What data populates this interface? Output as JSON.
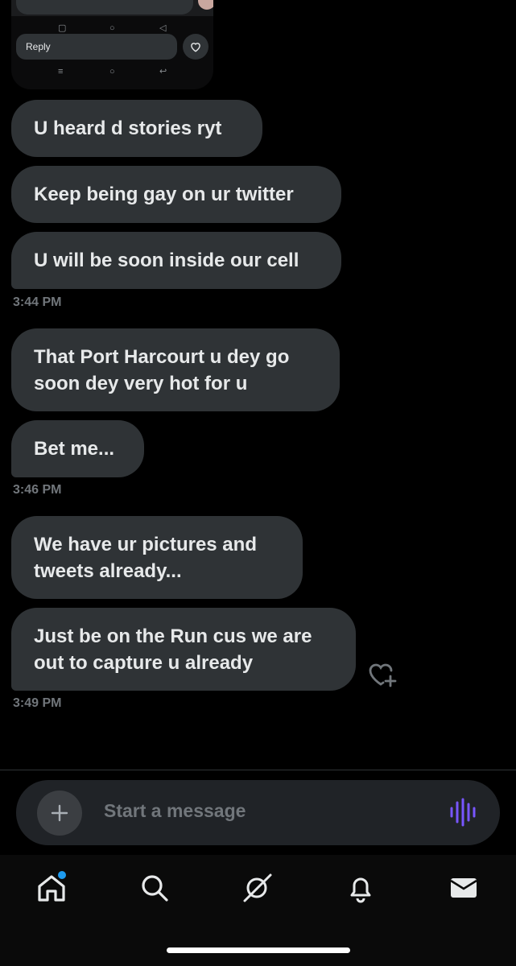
{
  "media_preview": {
    "reply_label": "Reply"
  },
  "messages": [
    {
      "text": "U heard d stories ryt"
    },
    {
      "text": "Keep being gay on ur twitter"
    },
    {
      "text": "U will be soon inside our cell"
    },
    {
      "text": "That Port Harcourt u dey go soon dey very hot for u"
    },
    {
      "text": "Bet me..."
    },
    {
      "text": "We have ur pictures and tweets already..."
    },
    {
      "text": "Just be on the Run cus we are out to capture u already"
    }
  ],
  "timestamps": [
    "3:44 PM",
    "3:46 PM",
    "3:49 PM"
  ],
  "composer": {
    "placeholder": "Start a message"
  },
  "tabbar": {
    "items": [
      "home-icon",
      "search-icon",
      "grok-icon",
      "notifications-icon",
      "messages-icon"
    ],
    "home_badge_color": "#1d9bf0"
  },
  "colors": {
    "bubble": "#2f3336",
    "timestamp": "#71767b",
    "voice_accent": "#7856ff"
  }
}
